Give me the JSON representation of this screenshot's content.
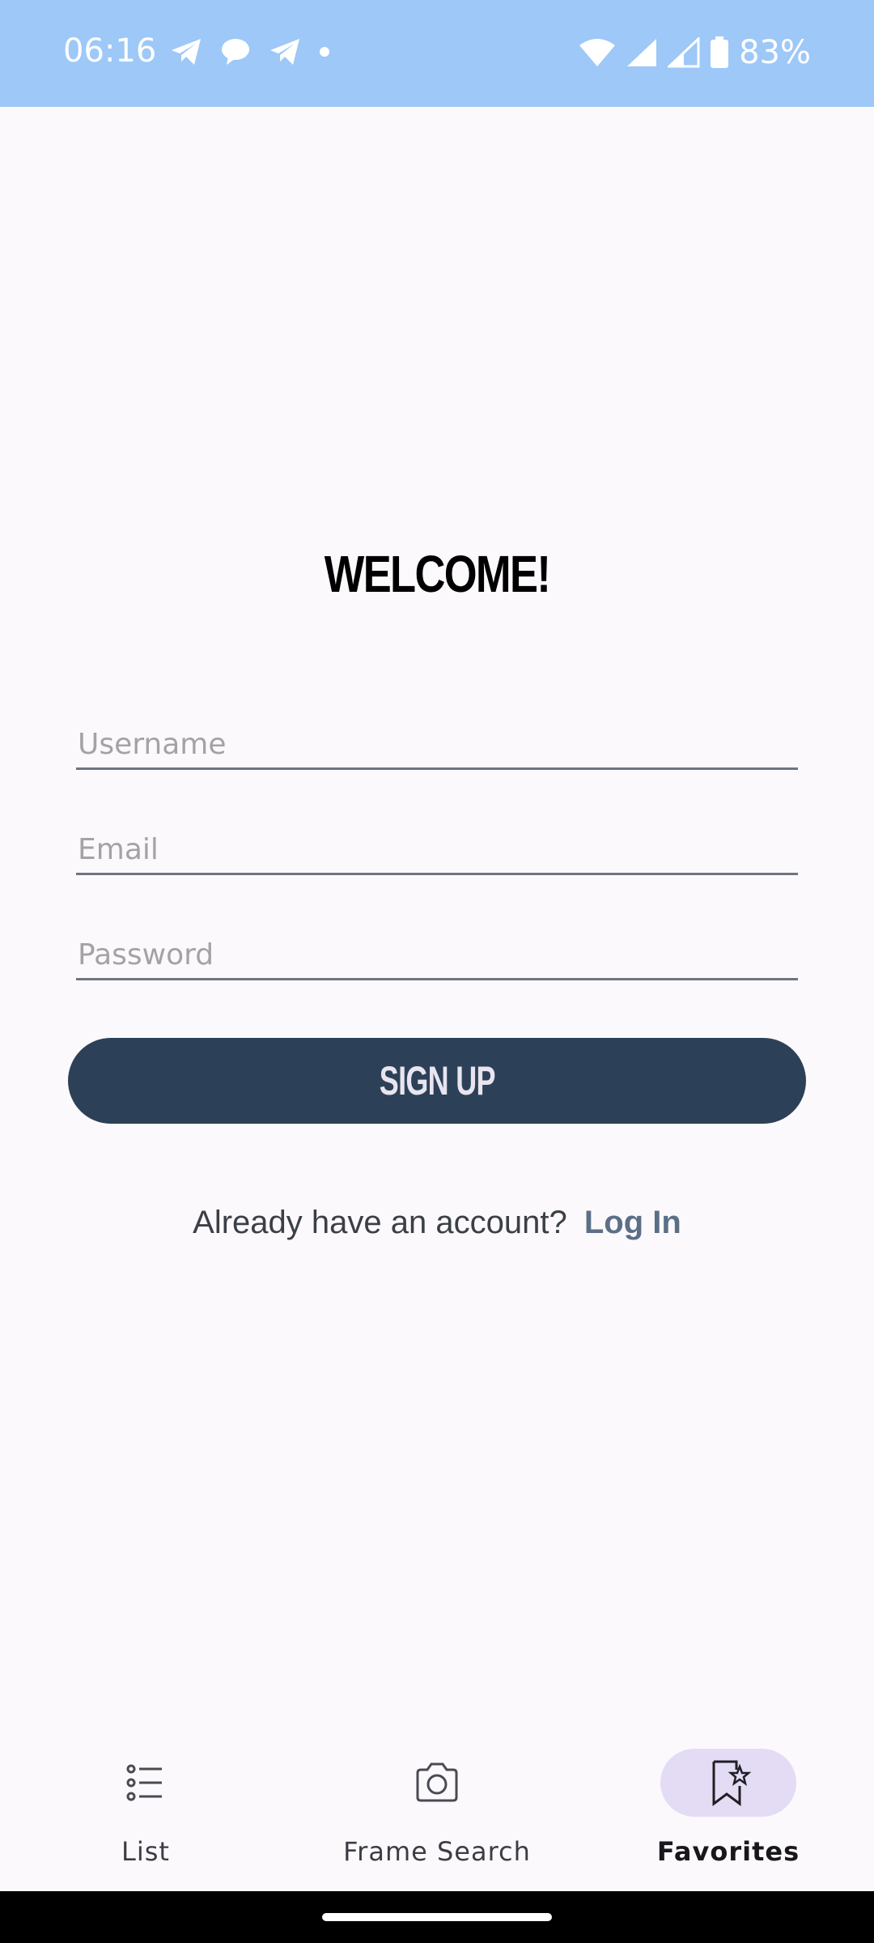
{
  "status_bar": {
    "time": "06:16",
    "battery_percent": "83%",
    "background_color": "#9dc8f8"
  },
  "screen": {
    "title": "WELCOME!",
    "username_placeholder": "Username",
    "email_placeholder": "Email",
    "password_placeholder": "Password",
    "signup_label": "SIGN UP",
    "login_prompt": "Already have an account?",
    "login_link": "Log In",
    "button_color": "#2c4157"
  },
  "bottom_nav": {
    "items": [
      {
        "label": "List",
        "icon": "list-icon",
        "active": false
      },
      {
        "label": "Frame Search",
        "icon": "camera-icon",
        "active": false
      },
      {
        "label": "Favorites",
        "icon": "bookmark-star-icon",
        "active": true
      }
    ]
  }
}
